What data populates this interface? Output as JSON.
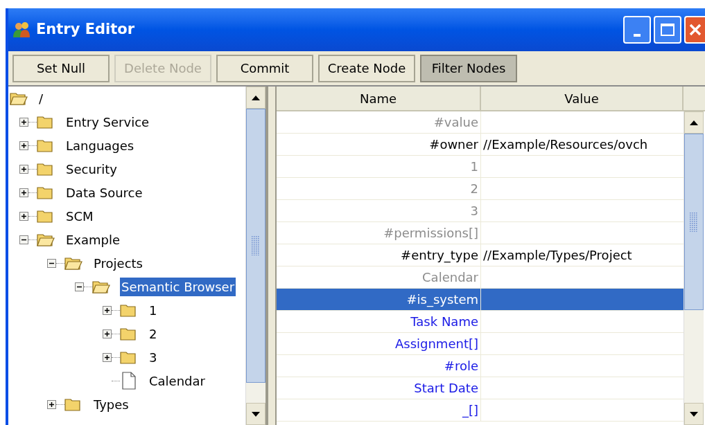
{
  "window": {
    "title": "Entry Editor"
  },
  "toolbar": [
    {
      "label": "Set Null",
      "disabled": false,
      "selected": false
    },
    {
      "label": "Delete Node",
      "disabled": true,
      "selected": false
    },
    {
      "label": "Commit",
      "disabled": false,
      "selected": false
    },
    {
      "label": "Create Node",
      "disabled": false,
      "selected": false
    },
    {
      "label": "Filter Nodes",
      "disabled": false,
      "selected": true
    }
  ],
  "tree": [
    {
      "label": "/",
      "kind": "folder",
      "expanded": true,
      "selected": false,
      "children": [
        {
          "label": "Entry Service",
          "kind": "folder",
          "expanded": false,
          "selected": false
        },
        {
          "label": "Languages",
          "kind": "folder",
          "expanded": false,
          "selected": false
        },
        {
          "label": "Security",
          "kind": "folder",
          "expanded": false,
          "selected": false
        },
        {
          "label": "Data Source",
          "kind": "folder",
          "expanded": false,
          "selected": false
        },
        {
          "label": "SCM",
          "kind": "folder",
          "expanded": false,
          "selected": false
        },
        {
          "label": "Example",
          "kind": "folder",
          "expanded": true,
          "selected": false,
          "children": [
            {
              "label": "Projects",
              "kind": "folder",
              "expanded": true,
              "selected": false,
              "children": [
                {
                  "label": "Semantic Browser",
                  "kind": "folder",
                  "expanded": true,
                  "selected": true,
                  "children": [
                    {
                      "label": "1",
                      "kind": "folder",
                      "expanded": false,
                      "selected": false
                    },
                    {
                      "label": "2",
                      "kind": "folder",
                      "expanded": false,
                      "selected": false
                    },
                    {
                      "label": "3",
                      "kind": "folder",
                      "expanded": false,
                      "selected": false
                    },
                    {
                      "label": "Calendar",
                      "kind": "file",
                      "selected": false
                    }
                  ]
                }
              ]
            },
            {
              "label": "Types",
              "kind": "folder",
              "expanded": false,
              "selected": false
            }
          ]
        }
      ]
    }
  ],
  "table": {
    "columns": [
      "Name",
      "Value"
    ],
    "rows": [
      {
        "name": "#value",
        "kind": "unset",
        "selected": false
      },
      {
        "name": "#owner",
        "value": "//Example/Resources/ovch",
        "kind": "set",
        "selected": false
      },
      {
        "name": "1",
        "kind": "unset",
        "selected": false
      },
      {
        "name": "2",
        "kind": "unset",
        "selected": false
      },
      {
        "name": "3",
        "kind": "unset",
        "selected": false
      },
      {
        "name": "#permissions[]",
        "kind": "unset",
        "selected": false
      },
      {
        "name": "#entry_type",
        "value": "//Example/Types/Project",
        "kind": "set",
        "selected": false
      },
      {
        "name": "Calendar",
        "kind": "unset",
        "selected": false
      },
      {
        "name": "#is_system",
        "selected": true
      },
      {
        "name": "Task Name",
        "kind": "field",
        "selected": false
      },
      {
        "name": "Assignment[]",
        "kind": "field",
        "selected": false
      },
      {
        "name": "#role",
        "kind": "field",
        "selected": false
      },
      {
        "name": "Start Date",
        "kind": "field",
        "selected": false
      },
      {
        "name": "_[]",
        "kind": "field",
        "selected": false
      }
    ]
  }
}
